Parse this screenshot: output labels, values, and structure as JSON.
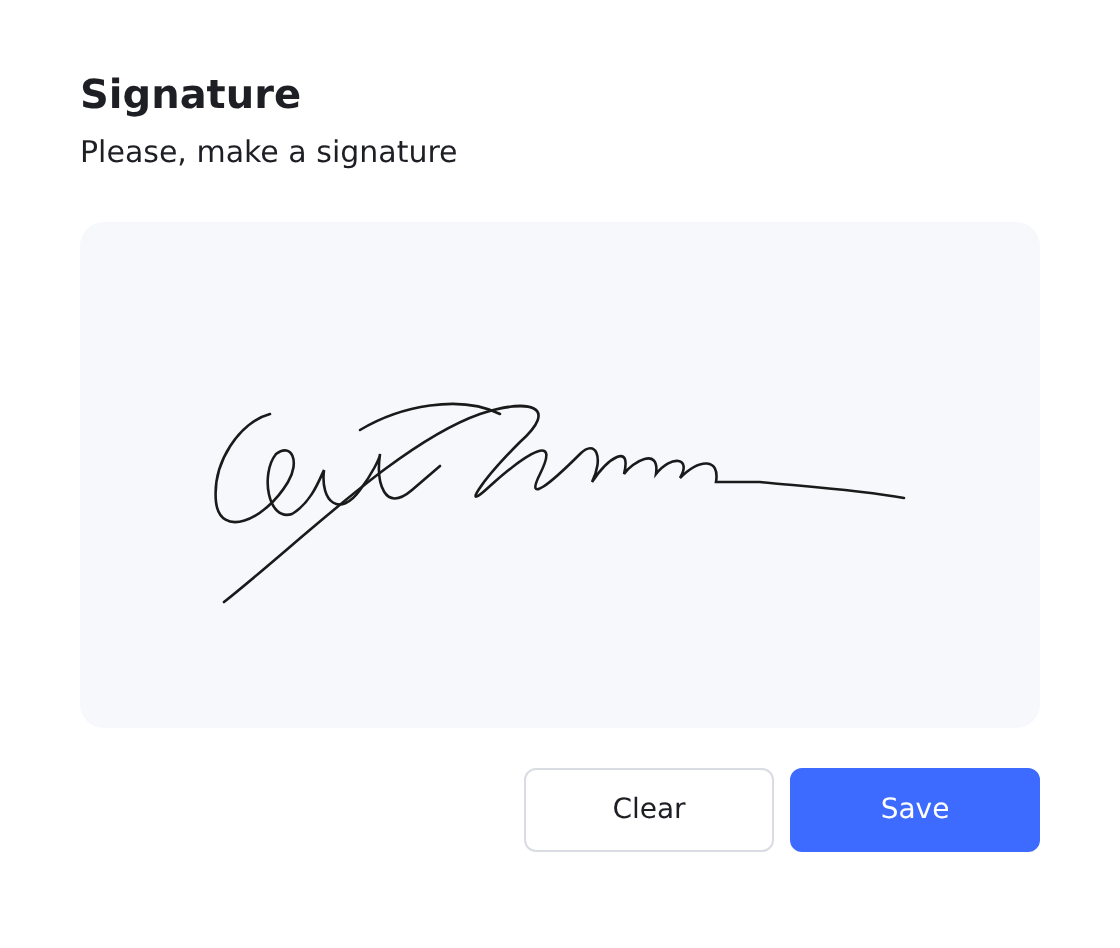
{
  "title": "Signature",
  "subtitle": "Please, make a signature",
  "buttons": [
    {
      "label": "Clear",
      "kind": "secondary"
    },
    {
      "label": "Save",
      "kind": "primary"
    }
  ]
}
